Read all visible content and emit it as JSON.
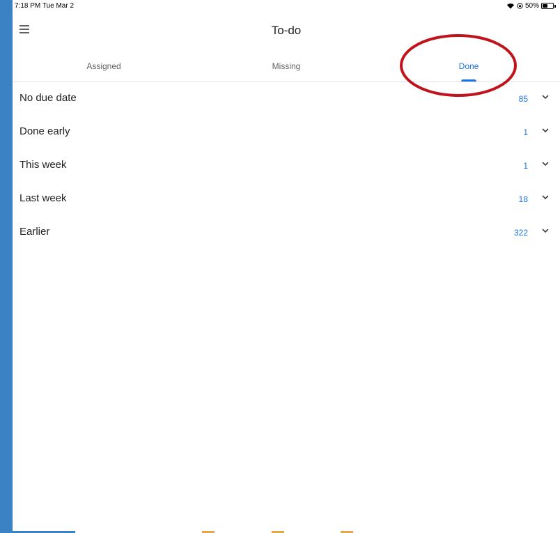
{
  "status_bar": {
    "time": "7:18 PM  Tue Mar 2",
    "battery": "50%",
    "battery_level": 0.5
  },
  "app_bar": {
    "title": "To-do"
  },
  "tabs": [
    {
      "label": "Assigned",
      "active": false
    },
    {
      "label": "Missing",
      "active": false
    },
    {
      "label": "Done",
      "active": true
    }
  ],
  "groups": [
    {
      "label": "No due date",
      "count": "85"
    },
    {
      "label": "Done early",
      "count": "1"
    },
    {
      "label": "This week",
      "count": "1"
    },
    {
      "label": "Last week",
      "count": "18"
    },
    {
      "label": "Earlier",
      "count": "322"
    }
  ],
  "icons": {
    "menu": "menu-icon",
    "wifi": "wifi-icon",
    "lock": "orientation-lock-icon",
    "battery": "battery-icon",
    "expand": "chevron-down-icon"
  },
  "colors": {
    "accent": "#1a73e8",
    "annotation": "#c0141c",
    "background_frame": "#3b82c4"
  }
}
